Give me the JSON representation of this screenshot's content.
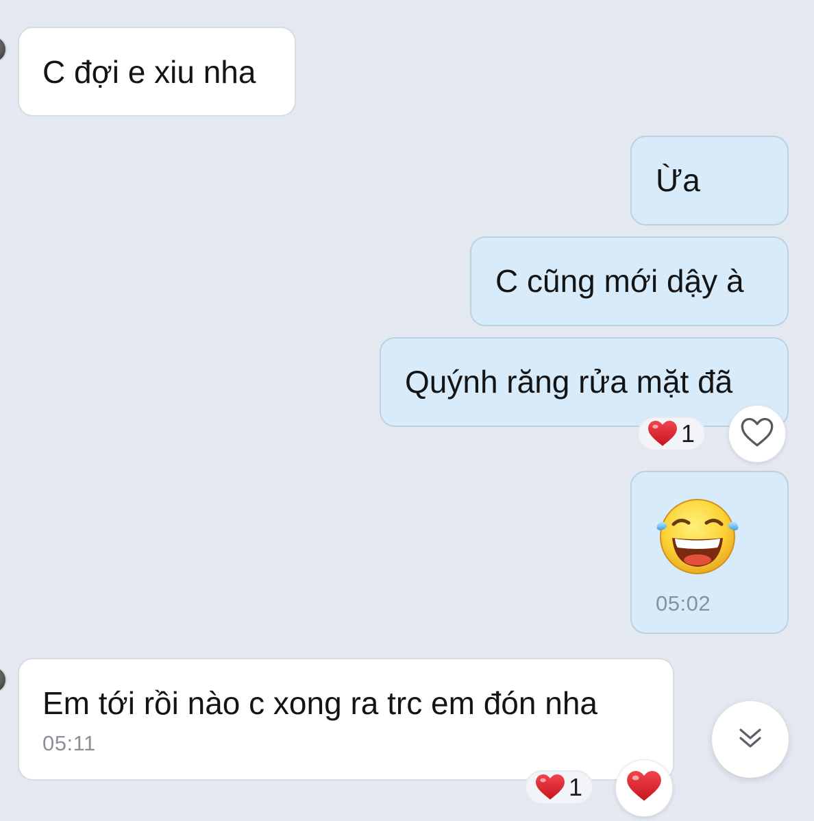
{
  "messages": [
    {
      "id": 1,
      "direction": "in",
      "text": "C đợi e xiu nha"
    },
    {
      "id": 2,
      "direction": "out",
      "text": "Ừa"
    },
    {
      "id": 3,
      "direction": "out",
      "text": "C cũng mới dậy à"
    },
    {
      "id": 4,
      "direction": "out",
      "text": "Quýnh răng rửa mặt đã",
      "reaction": {
        "emoji": "heart-icon",
        "count": "1"
      }
    },
    {
      "id": 5,
      "direction": "out",
      "sticker": "laughing-tears-emoji-icon",
      "time": "05:02"
    },
    {
      "id": 6,
      "direction": "in",
      "text": "Em tới rồi nào c xong ra trc em đón nha",
      "time": "05:11",
      "reaction": {
        "emoji": "heart-icon",
        "count": "1"
      }
    }
  ],
  "colors": {
    "background": "#e3e8f1",
    "incoming_bubble": "#ffffff",
    "outgoing_bubble": "#d7ebfb",
    "heart": "#e0262f",
    "timestamp": "#8b9097"
  },
  "icons": {
    "react_button_empty": "heart-outline-icon",
    "react_button_filled": "heart-icon",
    "scroll_down": "chevron-double-down-icon"
  }
}
